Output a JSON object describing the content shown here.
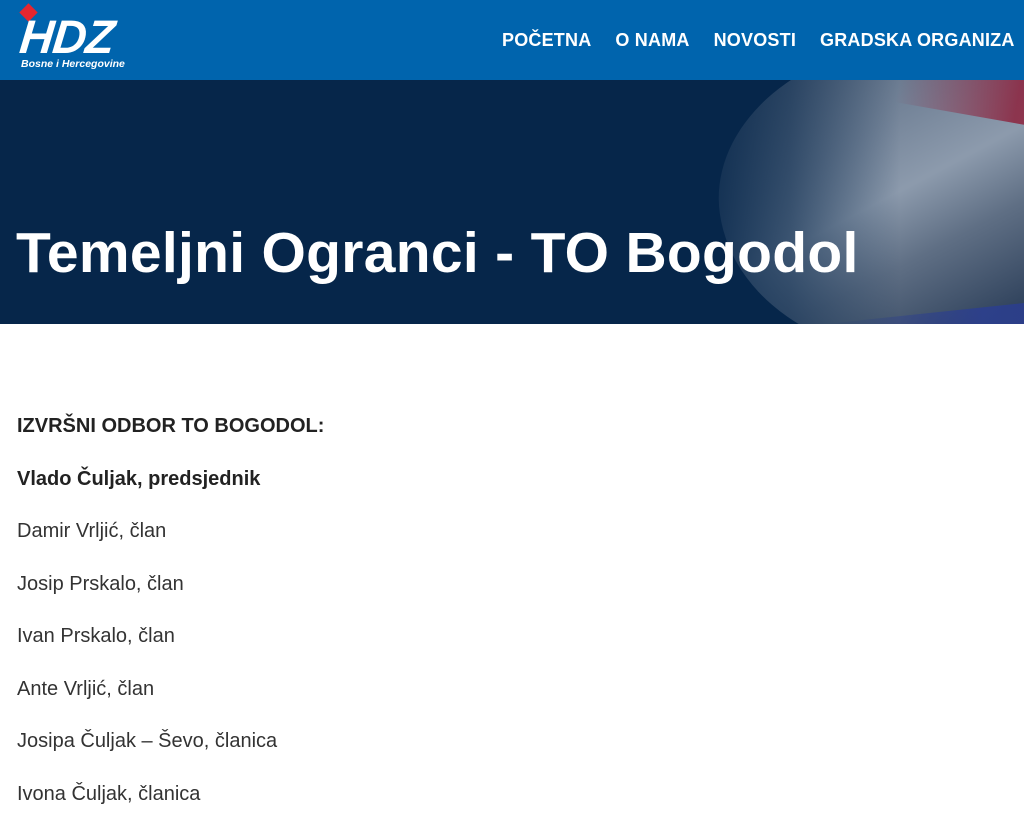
{
  "logo": {
    "text": "HDZ",
    "subtitle": "Bosne i Hercegovine"
  },
  "nav": {
    "items": [
      {
        "label": "POČETNA"
      },
      {
        "label": "O NAMA"
      },
      {
        "label": "NOVOSTI"
      },
      {
        "label": "GRADSKA ORGANIZA"
      }
    ]
  },
  "hero": {
    "title": "Temeljni Ogranci - TO Bogodol"
  },
  "content": {
    "heading": "IZVRŠNI ODBOR TO BOGODOL:",
    "president": "Vlado Čuljak, predsjednik",
    "members": [
      "Damir Vrljić, član",
      "Josip Prskalo, član",
      "Ivan Prskalo, član",
      "Ante Vrljić, član",
      "Josipa Čuljak – Ševo, članica",
      "Ivona Čuljak, članica"
    ]
  },
  "colors": {
    "header_bg": "#0064ad",
    "hero_bg": "#06264a",
    "logo_accent": "#e4262f",
    "text": "#333333"
  }
}
